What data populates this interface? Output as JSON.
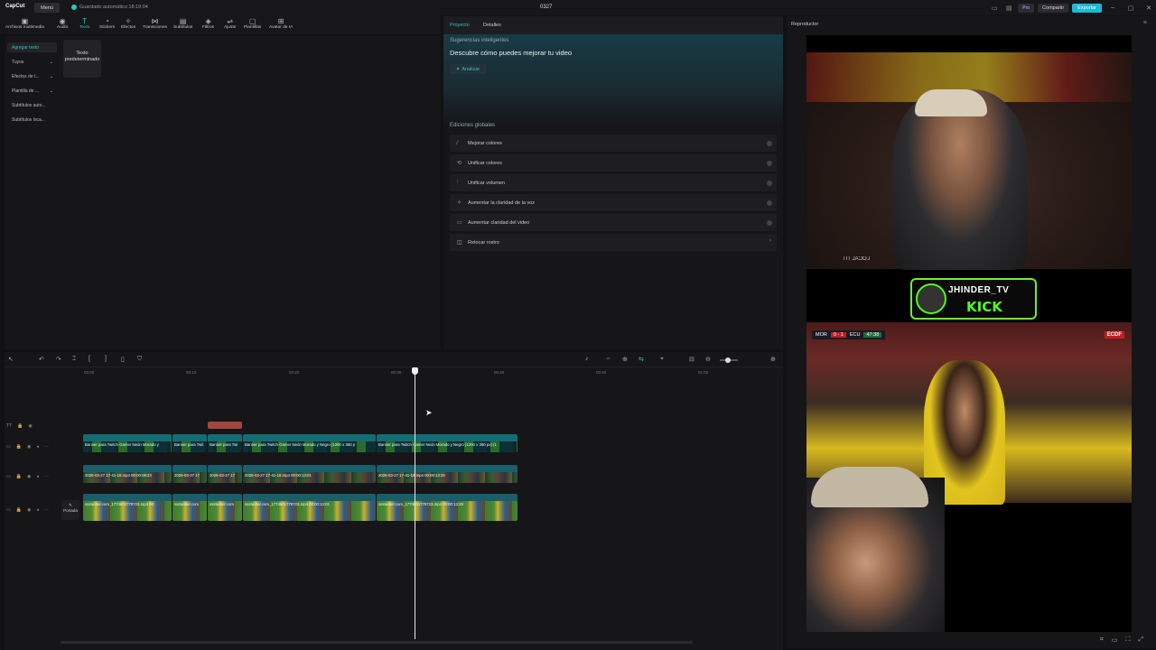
{
  "app": {
    "logo": "CapCut",
    "menu_label": "Menú",
    "autosave": "Guardado automático 18:19:04",
    "project_title": "0327",
    "pro_label": "Pro",
    "share_label": "Compartir",
    "export_label": "Exportar",
    "accent": "#28c7c7"
  },
  "toolbar": {
    "items": [
      {
        "label": "Archivos multimedia",
        "icon": "media-icon"
      },
      {
        "label": "Audio",
        "icon": "audio-icon"
      },
      {
        "label": "Texto",
        "icon": "text-icon"
      },
      {
        "label": "Stickers",
        "icon": "sticker-icon"
      },
      {
        "label": "Efectos",
        "icon": "effects-icon"
      },
      {
        "label": "Transiciones",
        "icon": "transition-icon"
      },
      {
        "label": "Subtítulos",
        "icon": "subtitle-icon"
      },
      {
        "label": "Filtros",
        "icon": "filter-icon"
      },
      {
        "label": "Ajuste",
        "icon": "adjust-icon"
      },
      {
        "label": "Plantillas",
        "icon": "template-icon"
      },
      {
        "label": "Avatar de IA",
        "icon": "avatar-icon"
      }
    ]
  },
  "sidebar": {
    "items": [
      {
        "label": "Agregar texto"
      },
      {
        "label": "Tuyos"
      },
      {
        "label": "Efectos de t..."
      },
      {
        "label": "Plantilla de ..."
      },
      {
        "label": "Subtítulos auto..."
      },
      {
        "label": "Subtítulos loca..."
      }
    ],
    "text_card": "Texto predeterminado"
  },
  "props": {
    "tab_project": "Proyecto",
    "tab_details": "Detalles",
    "smart_label": "Sugerencias inteligentes",
    "smart_title": "Descubre cómo puedes mejorar tu video",
    "analyze_label": "Analizar",
    "global_label": "Ediciones globales",
    "global_items": [
      {
        "label": "Mejorar colores"
      },
      {
        "label": "Unificar colores"
      },
      {
        "label": "Unificar volumen"
      },
      {
        "label": "Aumentar la claridad de la voz"
      },
      {
        "label": "Aumentar claridad del video"
      },
      {
        "label": "Retocar rostro"
      }
    ]
  },
  "player": {
    "title": "Reproductor",
    "cam_label": "LOCAL TIT",
    "banner_name": "JHINDER_TV",
    "banner_kick": "KICK",
    "score_home": "MOR",
    "score_value": "0 - 1",
    "score_away": "ECU",
    "score_time": "47:38",
    "broadcaster": "ECDF"
  },
  "timeline": {
    "ruler": [
      "00:00",
      "00:10",
      "00:20",
      "00:30",
      "00:40",
      "00:50",
      "01:00"
    ],
    "cover_label": "Portada",
    "banner_track": [
      {
        "label": "Banner para Twitch Gamer Neón Morado y"
      },
      {
        "label": "Banner para Twit"
      },
      {
        "label": "Banner para Twi"
      },
      {
        "label": "Banner para Twitch Gamer Neón Morado y Negro (1200 x 360 p"
      },
      {
        "label": "Banner para Twitch Gamer Neón Morado y Negro (1200 x 360 px) (1"
      }
    ],
    "cam_track": [
      {
        "label": "2026-03-27 17-41-18.mp4  00:00:08:23"
      },
      {
        "label": "2026-03-27 17"
      },
      {
        "label": "2026-03-27 17"
      },
      {
        "label": "2026-03-27 17-41-18.mp4  00:00:13:01"
      },
      {
        "label": "2026-03-27 17-41-18.mp4  00:00:13:28"
      }
    ],
    "soccer_track": [
      {
        "label": "ssstwitter.com_1774601779723.mp4  00:"
      },
      {
        "label": "ssstwitter.com"
      },
      {
        "label": "ssstwitter.com"
      },
      {
        "label": "ssstwitter.com_1774601779723.mp4  00:00:13:01"
      },
      {
        "label": "ssstwitter.com_1774601779723.mp4  00:00:13:28"
      }
    ]
  }
}
